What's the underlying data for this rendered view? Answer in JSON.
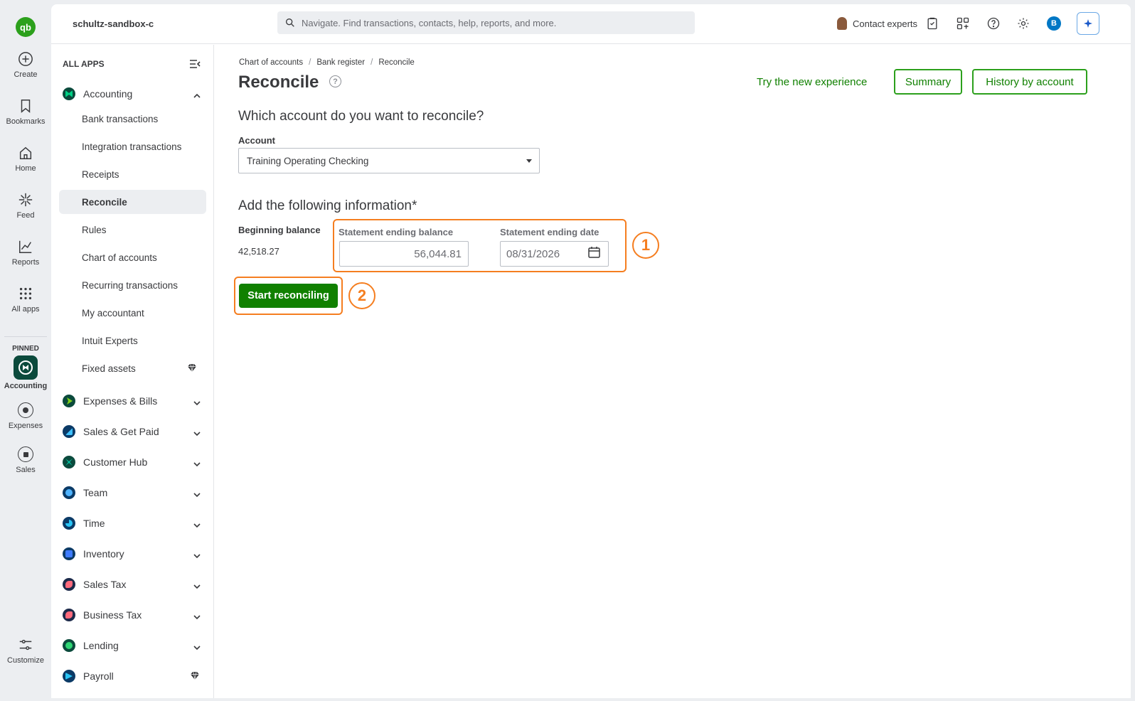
{
  "rail": {
    "logo_text": "qb",
    "items": [
      {
        "label": "Create"
      },
      {
        "label": "Bookmarks"
      },
      {
        "label": "Home"
      },
      {
        "label": "Feed"
      },
      {
        "label": "Reports"
      },
      {
        "label": "All apps"
      }
    ],
    "pinned_label": "PINNED",
    "pinned": [
      {
        "label": "Accounting"
      },
      {
        "label": "Expenses"
      },
      {
        "label": "Sales"
      }
    ],
    "customize_label": "Customize"
  },
  "topbar": {
    "company": "schultz-sandbox-c",
    "search_placeholder": "Navigate. Find transactions, contacts, help, reports, and more.",
    "contact_label": "Contact experts",
    "user_initial": "B"
  },
  "nav": {
    "heading": "ALL APPS",
    "accounting_label": "Accounting",
    "accounting_items": [
      {
        "label": "Bank transactions"
      },
      {
        "label": "Integration transactions"
      },
      {
        "label": "Receipts"
      },
      {
        "label": "Reconcile"
      },
      {
        "label": "Rules"
      },
      {
        "label": "Chart of accounts"
      },
      {
        "label": "Recurring transactions"
      },
      {
        "label": "My accountant"
      },
      {
        "label": "Intuit Experts"
      },
      {
        "label": "Fixed assets"
      }
    ],
    "groups": [
      {
        "label": "Expenses & Bills"
      },
      {
        "label": "Sales & Get Paid"
      },
      {
        "label": "Customer Hub"
      },
      {
        "label": "Team"
      },
      {
        "label": "Time"
      },
      {
        "label": "Inventory"
      },
      {
        "label": "Sales Tax"
      },
      {
        "label": "Business Tax"
      },
      {
        "label": "Lending"
      },
      {
        "label": "Payroll"
      }
    ]
  },
  "breadcrumb": [
    "Chart of accounts",
    "Bank register",
    "Reconcile"
  ],
  "page": {
    "title": "Reconcile",
    "try_new": "Try the new experience",
    "summary_button": "Summary",
    "history_button": "History by account",
    "question": "Which account do you want to reconcile?",
    "account_label": "Account",
    "account_value": "Training Operating Checking",
    "info_heading": "Add the following information*",
    "beginning_balance_label": "Beginning balance",
    "beginning_balance_value": "42,518.27",
    "ending_balance_label": "Statement ending balance",
    "ending_balance_value": "56,044.81",
    "ending_date_label": "Statement ending date",
    "ending_date_value": "08/31/2026",
    "start_button": "Start reconciling",
    "step1": "1",
    "step2": "2"
  },
  "colors": {
    "brand_green": "#2ca01c",
    "button_green": "#108000",
    "highlight_orange": "#f57e20",
    "accent_blue": "#0077c5"
  }
}
